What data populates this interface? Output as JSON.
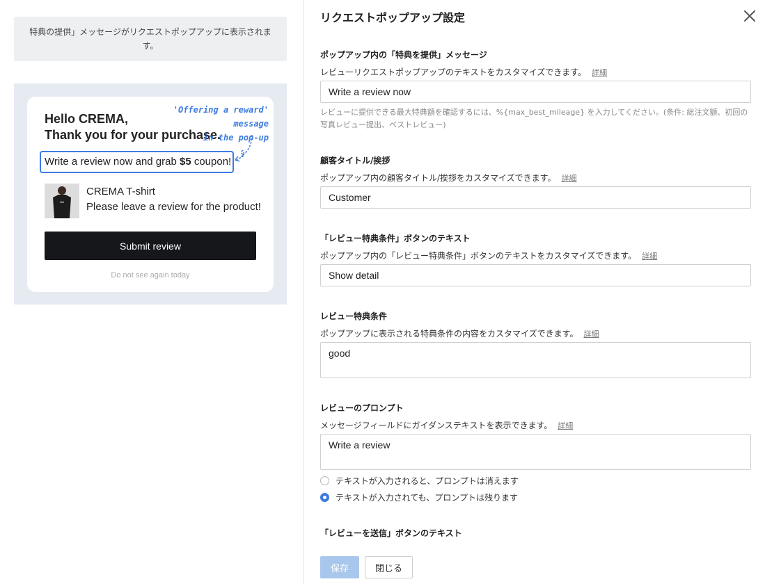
{
  "preview": {
    "notice": "特典の提供」メッセージがリクエストポップアップに表示されます。",
    "greeting_line1": "Hello CREMA,",
    "greeting_line2": "Thank you for your purchase.",
    "annotation_line1": "'Offering a reward' message",
    "annotation_line2": "in the pop-up",
    "reward_prefix": "Write a review now and grab ",
    "reward_amount": "$5",
    "reward_suffix": " coupon!",
    "product_name": "CREMA T-shirt",
    "product_subtitle": "Please leave a review for the product!",
    "submit_label": "Submit review",
    "dismiss_label": "Do not see again today",
    "accent_color": "#3d7be0"
  },
  "panel": {
    "title": "リクエストポップアップ設定",
    "close_icon": "close-icon",
    "detail_label": "詳細",
    "sections": {
      "reward_message": {
        "label": "ポップアップ内の「特典を提供」メッセージ",
        "desc": "レビューリクエストポップアップのテキストをカスタマイズできます。",
        "value": "Write a review now",
        "hint": "レビューに提供できる最大特典額を確認するには、%{max_best_mileage} を入力してください。(条件: 総注文額、初回の写真レビュー提出、ベストレビュー)"
      },
      "customer_title": {
        "label": "顧客タイトル/挨拶",
        "desc": "ポップアップ内の顧客タイトル/挨拶をカスタマイズできます。",
        "value": "Customer"
      },
      "condition_button": {
        "label": "「レビュー特典条件」ボタンのテキスト",
        "desc": "ポップアップ内の「レビュー特典条件」ボタンのテキストをカスタマイズできます。",
        "value": "Show detail"
      },
      "conditions": {
        "label": "レビュー特典条件",
        "desc": "ポップアップに表示される特典条件の内容をカスタマイズできます。",
        "value": "good"
      },
      "prompt": {
        "label": "レビューのプロンプト",
        "desc": "メッセージフィールドにガイダンステキストを表示できます。",
        "value": "Write a review",
        "options": [
          "テキストが入力されると、プロンプトは消えます",
          "テキストが入力されても、プロンプトは残ります"
        ],
        "selected_index": 1
      },
      "submit_button": {
        "label": "「レビューを送信」ボタンのテキスト"
      }
    },
    "save_label": "保存",
    "close_label": "閉じる"
  }
}
